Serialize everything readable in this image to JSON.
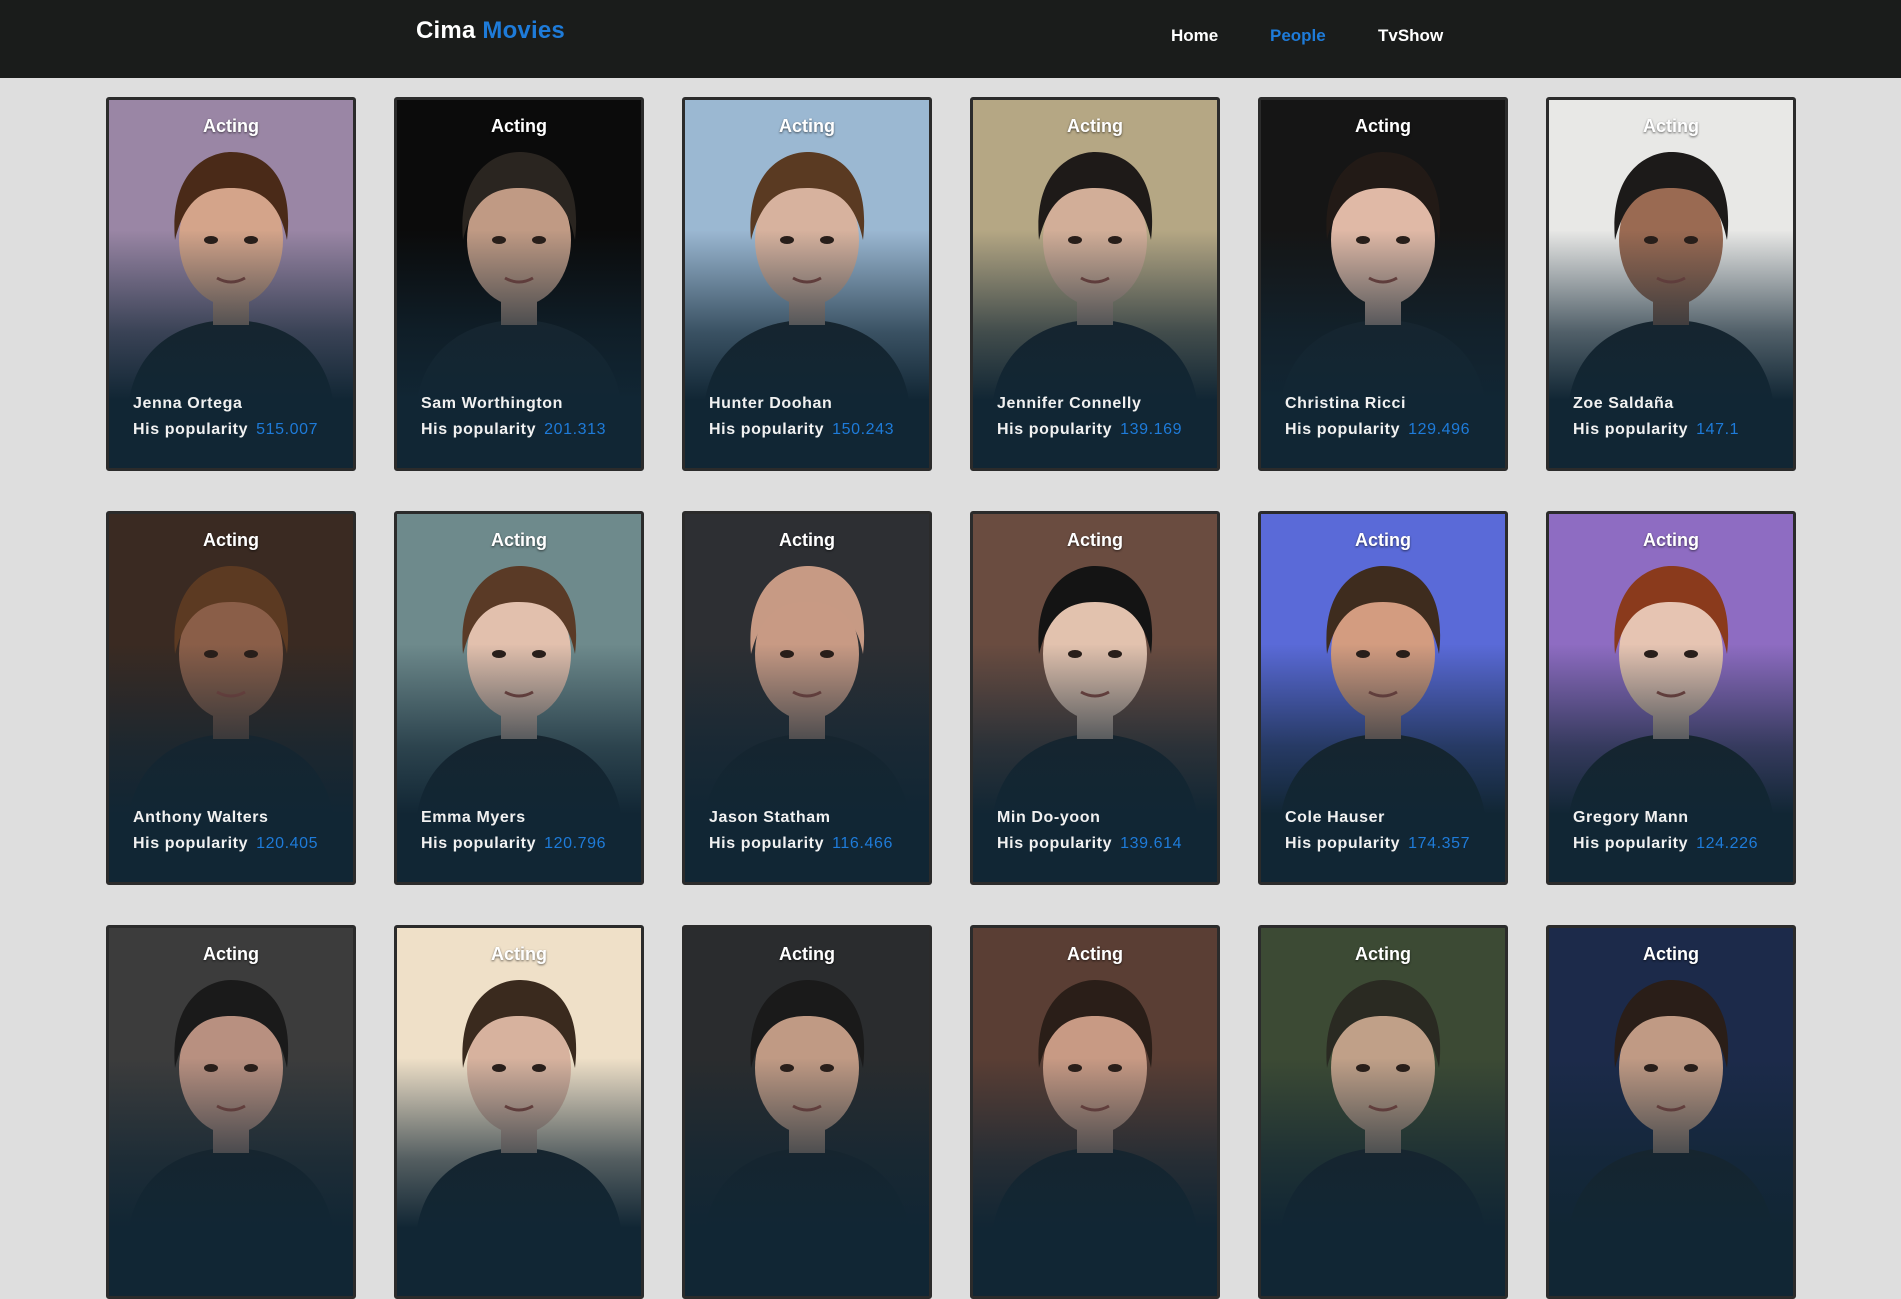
{
  "brand": {
    "name": "Cima",
    "accent": "Movies"
  },
  "nav": [
    {
      "label": "Home",
      "active": false
    },
    {
      "label": "People",
      "active": true
    },
    {
      "label": "TvShow",
      "active": false
    }
  ],
  "popularity_label": "His popularity",
  "colors": {
    "accent": "#1e7bd9",
    "navbar": "#1a1c1b",
    "page_bg": "#dedede",
    "card_bg": "#112634"
  },
  "people": [
    {
      "dept": "Acting",
      "name": "Jenna Ortega",
      "popularity": "515.007",
      "bg": "#9a86a5",
      "hair": "#4a2a18",
      "skin": "#d4a48a"
    },
    {
      "dept": "Acting",
      "name": "Sam Worthington",
      "popularity": "201.313",
      "bg": "#0b0b0b",
      "hair": "#2a2520",
      "skin": "#c09a84"
    },
    {
      "dept": "Acting",
      "name": "Hunter Doohan",
      "popularity": "150.243",
      "bg": "#9bb8d2",
      "hair": "#5a3a22",
      "skin": "#d7b29e"
    },
    {
      "dept": "Acting",
      "name": "Jennifer Connelly",
      "popularity": "139.169",
      "bg": "#b5a784",
      "hair": "#1e1a18",
      "skin": "#d2ae98"
    },
    {
      "dept": "Acting",
      "name": "Christina Ricci",
      "popularity": "129.496",
      "bg": "#151515",
      "hair": "#221a16",
      "skin": "#e0b9a6"
    },
    {
      "dept": "Acting",
      "name": "Zoe Saldaña",
      "popularity": "147.1",
      "bg": "#e8e8e6",
      "hair": "#1c1a19",
      "skin": "#9a6a52"
    },
    {
      "dept": "Acting",
      "name": "Anthony Walters",
      "popularity": "120.405",
      "bg": "#3a2a22",
      "hair": "#5c3a22",
      "skin": "#8a5e48"
    },
    {
      "dept": "Acting",
      "name": "Emma Myers",
      "popularity": "120.796",
      "bg": "#6e8a8c",
      "hair": "#5a3a26",
      "skin": "#e2c0ad"
    },
    {
      "dept": "Acting",
      "name": "Jason Statham",
      "popularity": "116.466",
      "bg": "#2d2f33",
      "hair": "#c79a84",
      "skin": "#c89a84"
    },
    {
      "dept": "Acting",
      "name": "Min Do-yoon",
      "popularity": "139.614",
      "bg": "#6a4c40",
      "hair": "#141414",
      "skin": "#e2c2ae"
    },
    {
      "dept": "Acting",
      "name": "Cole Hauser",
      "popularity": "174.357",
      "bg": "#5a6ad8",
      "hair": "#3e2c1e",
      "skin": "#d39c80"
    },
    {
      "dept": "Acting",
      "name": "Gregory Mann",
      "popularity": "124.226",
      "bg": "#8e6cc2",
      "hair": "#8a3a1c",
      "skin": "#e6c4b2"
    },
    {
      "dept": "Acting",
      "name": "",
      "popularity": "",
      "bg": "#3c3c3c",
      "hair": "#1a1a1a",
      "skin": "#b89080"
    },
    {
      "dept": "Acting",
      "name": "",
      "popularity": "",
      "bg": "#efe0c8",
      "hair": "#3a2a1e",
      "skin": "#d7b29e"
    },
    {
      "dept": "Acting",
      "name": "",
      "popularity": "",
      "bg": "#2a2c2e",
      "hair": "#1a1a1a",
      "skin": "#c09a84"
    },
    {
      "dept": "Acting",
      "name": "",
      "popularity": "",
      "bg": "#5a3e34",
      "hair": "#2a1e18",
      "skin": "#c89a84"
    },
    {
      "dept": "Acting",
      "name": "",
      "popularity": "",
      "bg": "#3c4a34",
      "hair": "#2a2a22",
      "skin": "#c0a088"
    },
    {
      "dept": "Acting",
      "name": "",
      "popularity": "",
      "bg": "#1c2a4a",
      "hair": "#2a1e18",
      "skin": "#c09a84"
    }
  ]
}
